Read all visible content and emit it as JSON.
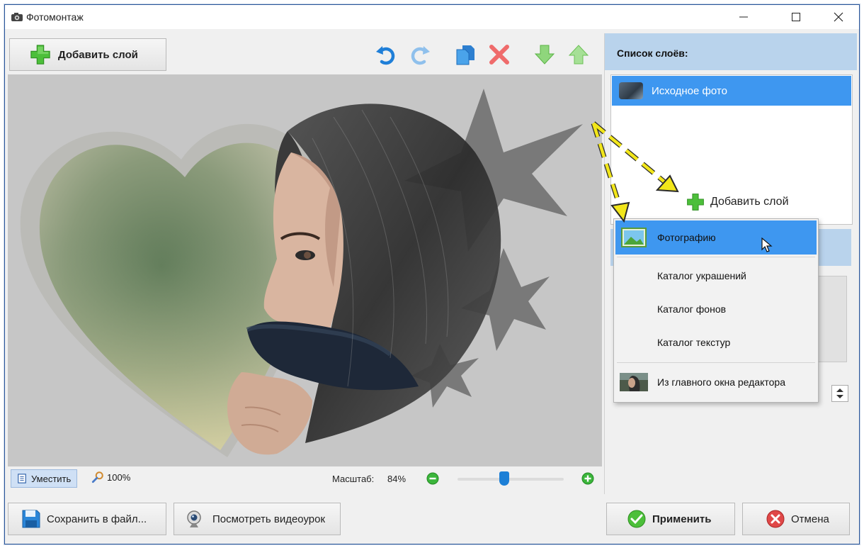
{
  "window": {
    "title": "Фотомонтаж",
    "controls": [
      "minimize",
      "maximize",
      "close"
    ]
  },
  "toolbar": {
    "add_layer_label": "Добавить слой",
    "tools": [
      "undo-icon",
      "redo-icon",
      "copy-icon",
      "delete-icon",
      "move-down-icon",
      "move-up-icon"
    ]
  },
  "status": {
    "fit_label": "Уместить",
    "actual_size_label": "100%",
    "zoom_caption": "Масштаб:",
    "zoom_value": "84%",
    "zoom_slider_fraction": 0.44
  },
  "bottom": {
    "save_label": "Сохранить в файл...",
    "video_label": "Посмотреть видеоурок",
    "apply_label": "Применить",
    "cancel_label": "Отмена"
  },
  "layers_panel": {
    "header": "Список слоёв:",
    "items": [
      {
        "label": "Исходное фото",
        "selected": true
      }
    ],
    "add_layer_label": "Добавить слой"
  },
  "add_menu": {
    "items": [
      {
        "label": "Фотографию",
        "highlighted": true,
        "icon": "photo-icon"
      },
      {
        "label": "Каталог украшений"
      },
      {
        "label": "Каталог фонов"
      },
      {
        "label": "Каталог текстур"
      },
      {
        "label": "Из главного окна редактора",
        "icon": "editor-thumb"
      }
    ]
  },
  "colors": {
    "accent": "#3e97f0",
    "panel_header": "#b9d3ec",
    "canvas_bg": "#c8c8c8",
    "annotation_arrow": "#f2e61a"
  }
}
